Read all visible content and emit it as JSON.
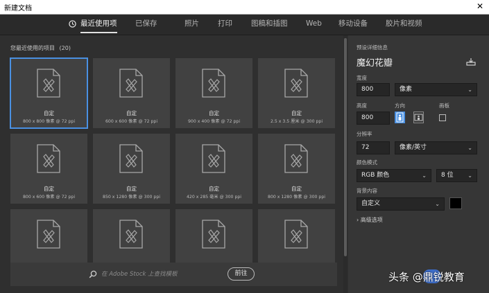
{
  "window": {
    "title": "新建文档",
    "close_glyph": "✕"
  },
  "tabs": [
    {
      "label": "最近使用项",
      "active": true
    },
    {
      "label": "已保存"
    },
    {
      "label": "照片"
    },
    {
      "label": "打印"
    },
    {
      "label": "图稿和插图"
    },
    {
      "label": "Web"
    },
    {
      "label": "移动设备"
    },
    {
      "label": "胶片和视频"
    }
  ],
  "recent": {
    "heading": "您最近使用的项目",
    "count": "(20)",
    "cards": [
      {
        "name": "自定",
        "meta": "800 x 800 像素 @ 72 ppi",
        "selected": true
      },
      {
        "name": "自定",
        "meta": "600 x 600 像素 @ 72 ppi"
      },
      {
        "name": "自定",
        "meta": "900 x 400 像素 @ 72 ppi"
      },
      {
        "name": "自定",
        "meta": "2.5 x 3.5 厘米 @ 300 ppi"
      },
      {
        "name": "自定",
        "meta": "800 x 600 像素 @ 72 ppi"
      },
      {
        "name": "自定",
        "meta": "850 x 1280 像素 @ 300 ppi"
      },
      {
        "name": "自定",
        "meta": "420 x 285 毫米 @ 300 ppi"
      },
      {
        "name": "自定",
        "meta": "800 x 1280 像素 @ 300 ppi"
      },
      {
        "name": "",
        "meta": ""
      },
      {
        "name": "",
        "meta": ""
      },
      {
        "name": "",
        "meta": ""
      },
      {
        "name": "",
        "meta": ""
      }
    ]
  },
  "search": {
    "placeholder": "在 Adobe Stock 上查找模板",
    "go_label": "前往"
  },
  "details": {
    "section_label": "预设详细信息",
    "preset_name": "魔幻花瓣",
    "width_label": "宽度",
    "width_value": "800",
    "width_unit": "像素",
    "height_label": "高度",
    "height_value": "800",
    "orientation_label": "方向",
    "artboard_label": "画板",
    "resolution_label": "分辨率",
    "resolution_value": "72",
    "resolution_unit": "像素/英寸",
    "color_mode_label": "颜色模式",
    "color_mode_value": "RGB 颜色",
    "bit_depth_value": "8 位",
    "background_label": "背景内容",
    "background_value": "自定义",
    "background_color": "#000000",
    "advanced_label": "高级选项",
    "advanced_glyph": "›"
  },
  "watermark": {
    "text": "头条 @鼎锐教育"
  },
  "colors": {
    "accent": "#4a90e2",
    "panel": "#363636",
    "background": "#2f2f2f"
  }
}
